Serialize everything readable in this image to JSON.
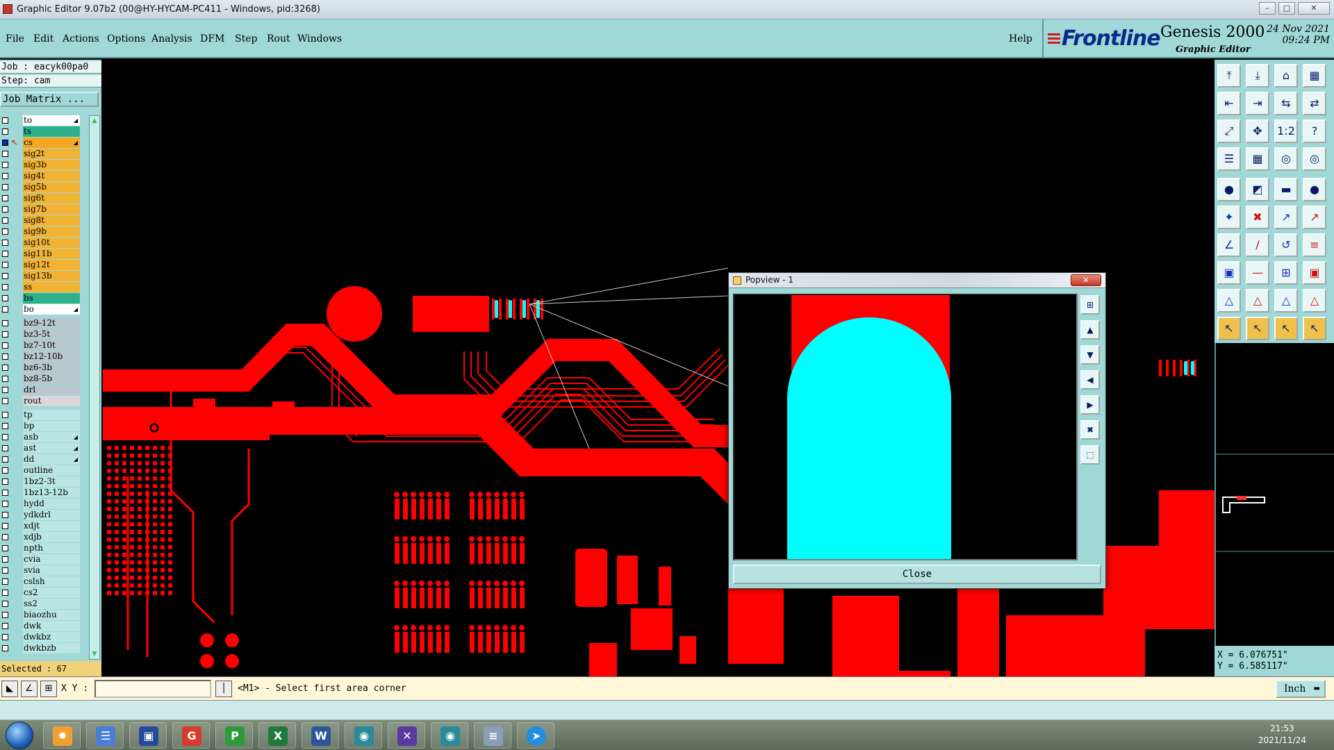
{
  "window": {
    "title": "Graphic Editor 9.07b2 (00@HY-HYCAM-PC411 - Windows, pid:3268)"
  },
  "menu": {
    "items": [
      "File",
      "Edit",
      "Actions",
      "Options",
      "Analysis",
      "DFM",
      "Step",
      "Rout",
      "Windows"
    ],
    "help": "Help"
  },
  "brand": {
    "logo": "Frontline",
    "product": "Genesis 2000",
    "subtitle": "Graphic Editor",
    "date": "24 Nov 2021",
    "time": "09:24 PM"
  },
  "job": {
    "job_line": "Job : eacyk00pa0",
    "step_line": "Step: cam",
    "matrix_button": "Job Matrix ..."
  },
  "layers": [
    {
      "name": "to",
      "color": "#ffffff",
      "tick": true,
      "check": "empty"
    },
    {
      "name": "ts",
      "color": "#2fb08c",
      "tick": false,
      "check": "empty"
    },
    {
      "name": "cs",
      "color": "#f5a623",
      "tick": true,
      "check": "work"
    },
    {
      "name": "sig2t",
      "color": "#f2b233",
      "tick": false,
      "check": "empty"
    },
    {
      "name": "sig3b",
      "color": "#f2b233",
      "tick": false,
      "check": "empty"
    },
    {
      "name": "sig4t",
      "color": "#f2b233",
      "tick": false,
      "check": "empty"
    },
    {
      "name": "sig5b",
      "color": "#f2b233",
      "tick": false,
      "check": "empty"
    },
    {
      "name": "sig6t",
      "color": "#f2b233",
      "tick": false,
      "check": "empty"
    },
    {
      "name": "sig7b",
      "color": "#f2b233",
      "tick": false,
      "check": "empty"
    },
    {
      "name": "sig8t",
      "color": "#f2b233",
      "tick": false,
      "check": "empty"
    },
    {
      "name": "sig9b",
      "color": "#f2b233",
      "tick": false,
      "check": "empty"
    },
    {
      "name": "sig10t",
      "color": "#f2b233",
      "tick": false,
      "check": "empty"
    },
    {
      "name": "sig11b",
      "color": "#f2b233",
      "tick": false,
      "check": "empty"
    },
    {
      "name": "sig12t",
      "color": "#f2b233",
      "tick": false,
      "check": "empty"
    },
    {
      "name": "sig13b",
      "color": "#f2b233",
      "tick": false,
      "check": "empty"
    },
    {
      "name": "ss",
      "color": "#f2b233",
      "tick": false,
      "check": "empty"
    },
    {
      "name": "bs",
      "color": "#2fb08c",
      "tick": false,
      "check": "empty"
    },
    {
      "name": "bo",
      "color": "#ffffff",
      "tick": true,
      "check": "empty"
    },
    {
      "name": "bz9-12t",
      "color": "#b9c7cf",
      "tick": false,
      "check": "empty"
    },
    {
      "name": "bz3-5t",
      "color": "#b9c7cf",
      "tick": false,
      "check": "empty"
    },
    {
      "name": "bz7-10t",
      "color": "#b9c7cf",
      "tick": false,
      "check": "empty"
    },
    {
      "name": "bz12-10b",
      "color": "#b9c7cf",
      "tick": false,
      "check": "empty"
    },
    {
      "name": "bz6-3b",
      "color": "#b9c7cf",
      "tick": false,
      "check": "empty"
    },
    {
      "name": "bz8-5b",
      "color": "#b9c7cf",
      "tick": false,
      "check": "empty"
    },
    {
      "name": "drl",
      "color": "#b9c7cf",
      "tick": false,
      "check": "empty"
    },
    {
      "name": "rout",
      "color": "#d9d9d9",
      "tick": false,
      "check": "empty"
    },
    {
      "name": "tp",
      "color": "#b9e6e4",
      "tick": false,
      "check": "empty"
    },
    {
      "name": "bp",
      "color": "#b9e6e4",
      "tick": false,
      "check": "empty"
    },
    {
      "name": "asb",
      "color": "#b9e6e4",
      "tick": true,
      "check": "empty"
    },
    {
      "name": "ast",
      "color": "#b9e6e4",
      "tick": true,
      "check": "empty"
    },
    {
      "name": "dd",
      "color": "#b9e6e4",
      "tick": true,
      "check": "empty"
    },
    {
      "name": "outline",
      "color": "#b9e6e4",
      "tick": false,
      "check": "empty"
    },
    {
      "name": "1bz2-3t",
      "color": "#b9e6e4",
      "tick": false,
      "check": "empty"
    },
    {
      "name": "1bz13-12b",
      "color": "#b9e6e4",
      "tick": false,
      "check": "empty"
    },
    {
      "name": "hydd",
      "color": "#b9e6e4",
      "tick": false,
      "check": "empty"
    },
    {
      "name": "ydkdrl",
      "color": "#b9e6e4",
      "tick": false,
      "check": "empty"
    },
    {
      "name": "xdjt",
      "color": "#b9e6e4",
      "tick": false,
      "check": "empty"
    },
    {
      "name": "xdjb",
      "color": "#b9e6e4",
      "tick": false,
      "check": "empty"
    },
    {
      "name": "npth",
      "color": "#b9e6e4",
      "tick": false,
      "check": "empty"
    },
    {
      "name": "cvia",
      "color": "#b9e6e4",
      "tick": false,
      "check": "empty"
    },
    {
      "name": "svia",
      "color": "#b9e6e4",
      "tick": false,
      "check": "empty"
    },
    {
      "name": "cslsh",
      "color": "#b9e6e4",
      "tick": false,
      "check": "empty"
    },
    {
      "name": "cs2",
      "color": "#b9e6e4",
      "tick": false,
      "check": "empty"
    },
    {
      "name": "ss2",
      "color": "#b9e6e4",
      "tick": false,
      "check": "empty"
    },
    {
      "name": "biaozhu",
      "color": "#b9e6e4",
      "tick": false,
      "check": "empty"
    },
    {
      "name": "dwk",
      "color": "#b9e6e4",
      "tick": false,
      "check": "empty"
    },
    {
      "name": "dwkbz",
      "color": "#b9e6e4",
      "tick": false,
      "check": "empty"
    },
    {
      "name": "dwkbzb",
      "color": "#b9e6e4",
      "tick": false,
      "check": "empty"
    }
  ],
  "selected": "Selected : 67",
  "coords": {
    "x": "X = 6.076751\"",
    "y": "Y = 6.585117\""
  },
  "status": {
    "xy_label": "X Y :",
    "xy_value": "",
    "prompt": "<M1> - Select first area corner",
    "units": "Inch"
  },
  "popview": {
    "title": "Popview - 1",
    "close_label": "Close"
  },
  "taskbar": {
    "time": "21:53",
    "date": "2021/11/24"
  },
  "colors": {
    "copper": "#ff0000",
    "highlight": "#00ffff",
    "panel": "#9fd8d6"
  }
}
